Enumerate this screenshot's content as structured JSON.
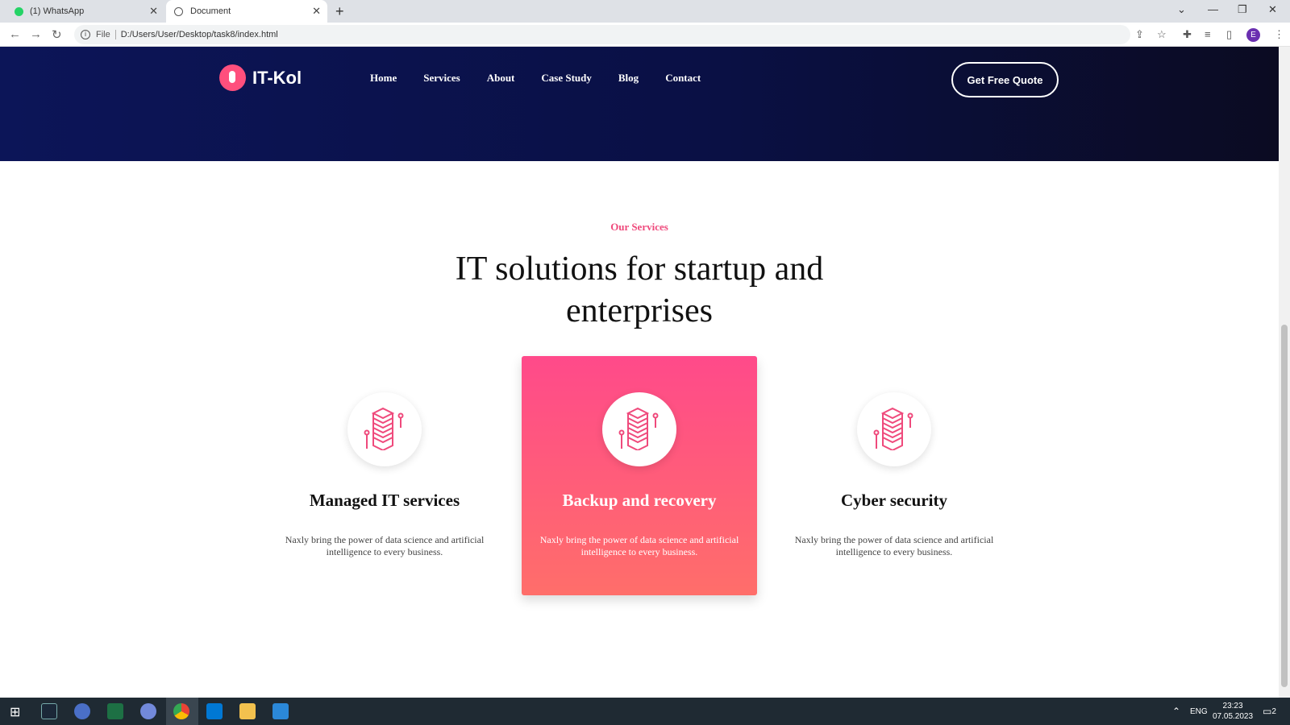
{
  "browser": {
    "tabs": [
      {
        "label": "(1) WhatsApp"
      },
      {
        "label": "Document"
      }
    ],
    "new_tab": "+",
    "url_scheme": "File",
    "url": "D:/Users/User/Desktop/task8/index.html",
    "profile_initial": "E"
  },
  "site": {
    "logo": "IT-Kol",
    "nav": [
      "Home",
      "Services",
      "About",
      "Case Study",
      "Blog",
      "Contact"
    ],
    "cta": "Get Free Quote"
  },
  "services": {
    "eyebrow": "Our Services",
    "heading": "IT solutions for startup and enterprises",
    "cards": [
      {
        "title": "Managed IT services",
        "text": "Naxly bring the power of data science and artificial intelligence to every business.",
        "icon": "server-stack-icon",
        "active": false
      },
      {
        "title": "Backup and recovery",
        "text": "Naxly bring the power of data science and artificial intelligence to every business.",
        "icon": "server-stack-icon",
        "active": true
      },
      {
        "title": "Cyber security",
        "text": "Naxly bring the power of data science and artificial intelligence to every business.",
        "icon": "server-stack-icon",
        "active": false
      }
    ]
  },
  "taskbar": {
    "language": "ENG",
    "time": "23:23",
    "date": "07.05.2023",
    "notifications": "2"
  },
  "colors": {
    "accent": "#ef4a7c",
    "hero_dark": "#0a1045"
  }
}
